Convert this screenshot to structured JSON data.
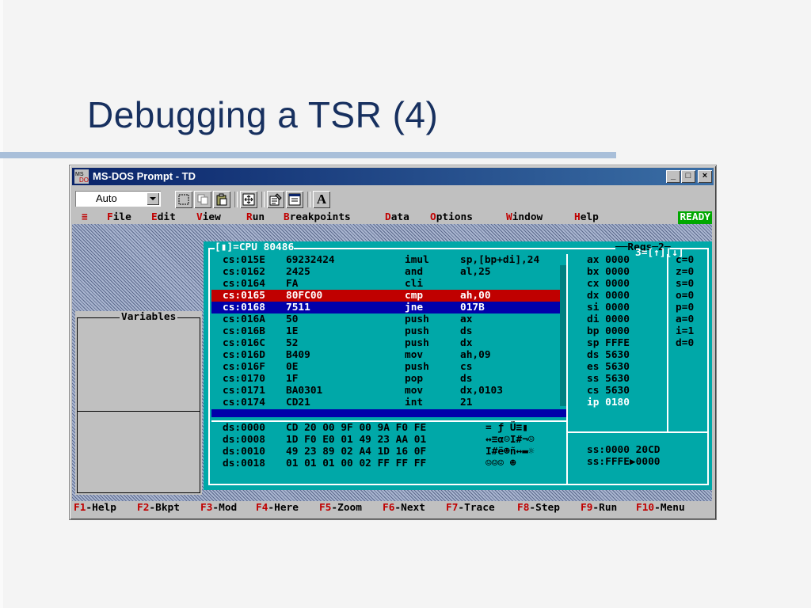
{
  "slide": {
    "title": "Debugging a TSR (4)"
  },
  "window": {
    "title": "MS-DOS Prompt - TD",
    "controls": {
      "minimize": "_",
      "maximize": "□",
      "close": "×"
    },
    "toolbar": {
      "font_size": "Auto",
      "font_label": "A"
    }
  },
  "td": {
    "menu": [
      {
        "hot": "≡",
        "rest": ""
      },
      {
        "hot": "F",
        "rest": "ile"
      },
      {
        "hot": "E",
        "rest": "dit"
      },
      {
        "hot": "V",
        "rest": "iew"
      },
      {
        "hot": "R",
        "rest": "un"
      },
      {
        "hot": "B",
        "rest": "reakpoints"
      },
      {
        "hot": "D",
        "rest": "ata"
      },
      {
        "hot": "O",
        "rest": "ptions"
      },
      {
        "hot": "W",
        "rest": "indow"
      },
      {
        "hot": "H",
        "rest": "elp"
      }
    ],
    "status": "READY",
    "variables_title": "Variables",
    "cpu_title": "[▮]=CPU 80486",
    "regs_title": "Regs",
    "regs_index": "2",
    "regs_right": "3=[↑][↓]",
    "code": [
      {
        "addr": "cs:015E",
        "bytes": "69232424",
        "mnem": "imul",
        "ops": "sp,[bp+di],24"
      },
      {
        "addr": "cs:0162",
        "bytes": "2425",
        "mnem": "and",
        "ops": "al,25"
      },
      {
        "addr": "cs:0164",
        "bytes": "FA",
        "mnem": "cli",
        "ops": ""
      },
      {
        "addr": "cs:0165",
        "bytes": "80FC00",
        "mnem": "cmp",
        "ops": "ah,00"
      },
      {
        "addr": "cs:0168",
        "bytes": "7511",
        "mnem": "jne",
        "ops": "017B"
      },
      {
        "addr": "cs:016A",
        "bytes": "50",
        "mnem": "push",
        "ops": "ax"
      },
      {
        "addr": "cs:016B",
        "bytes": "1E",
        "mnem": "push",
        "ops": "ds"
      },
      {
        "addr": "cs:016C",
        "bytes": "52",
        "mnem": "push",
        "ops": "dx"
      },
      {
        "addr": "cs:016D",
        "bytes": "B409",
        "mnem": "mov",
        "ops": "ah,09"
      },
      {
        "addr": "cs:016F",
        "bytes": "0E",
        "mnem": "push",
        "ops": "cs"
      },
      {
        "addr": "cs:0170",
        "bytes": "1F",
        "mnem": "pop",
        "ops": "ds"
      },
      {
        "addr": "cs:0171",
        "bytes": "BA0301",
        "mnem": "mov",
        "ops": "dx,0103"
      },
      {
        "addr": "cs:0174",
        "bytes": "CD21",
        "mnem": "int",
        "ops": "21"
      }
    ],
    "dump": [
      {
        "addr": "ds:0000",
        "hex": "CD 20 00 9F 00 9A F0 FE",
        "ascii": "= ƒ Ü≡▮"
      },
      {
        "addr": "ds:0008",
        "hex": "1D F0 E0 01 49 23 AA 01",
        "ascii": "↔≡α☺I#¬☺"
      },
      {
        "addr": "ds:0010",
        "hex": "49 23 89 02 A4 1D 16 0F",
        "ascii": "I#ë☻ñ↔▬☼"
      },
      {
        "addr": "ds:0018",
        "hex": "01 01 01 00 02 FF FF FF",
        "ascii": "☺☺☺ ☻"
      }
    ],
    "registers": [
      {
        "name": "ax",
        "value": "0000"
      },
      {
        "name": "bx",
        "value": "0000"
      },
      {
        "name": "cx",
        "value": "0000"
      },
      {
        "name": "dx",
        "value": "0000"
      },
      {
        "name": "si",
        "value": "0000"
      },
      {
        "name": "di",
        "value": "0000"
      },
      {
        "name": "bp",
        "value": "0000"
      },
      {
        "name": "sp",
        "value": "FFFE"
      },
      {
        "name": "ds",
        "value": "5630"
      },
      {
        "name": "es",
        "value": "5630"
      },
      {
        "name": "ss",
        "value": "5630"
      },
      {
        "name": "cs",
        "value": "5630"
      },
      {
        "name": "ip",
        "value": "0180"
      }
    ],
    "flags": [
      {
        "name": "c",
        "value": "0"
      },
      {
        "name": "z",
        "value": "0"
      },
      {
        "name": "s",
        "value": "0"
      },
      {
        "name": "o",
        "value": "0"
      },
      {
        "name": "p",
        "value": "0"
      },
      {
        "name": "a",
        "value": "0"
      },
      {
        "name": "i",
        "value": "1"
      },
      {
        "name": "d",
        "value": "0"
      }
    ],
    "stack": [
      {
        "addr": "ss:0000",
        "value": "20CD"
      },
      {
        "addr": "ss:FFFE",
        "value": "0000"
      }
    ],
    "fkeys": [
      {
        "key": "F1",
        "label": "-Help"
      },
      {
        "key": "F2",
        "label": "-Bkpt"
      },
      {
        "key": "F3",
        "label": "-Mod"
      },
      {
        "key": "F4",
        "label": "-Here"
      },
      {
        "key": "F5",
        "label": "-Zoom"
      },
      {
        "key": "F6",
        "label": "-Next"
      },
      {
        "key": "F7",
        "label": "-Trace"
      },
      {
        "key": "F8",
        "label": "-Step"
      },
      {
        "key": "F9",
        "label": "-Run"
      },
      {
        "key": "F10",
        "label": "-Menu"
      }
    ]
  }
}
